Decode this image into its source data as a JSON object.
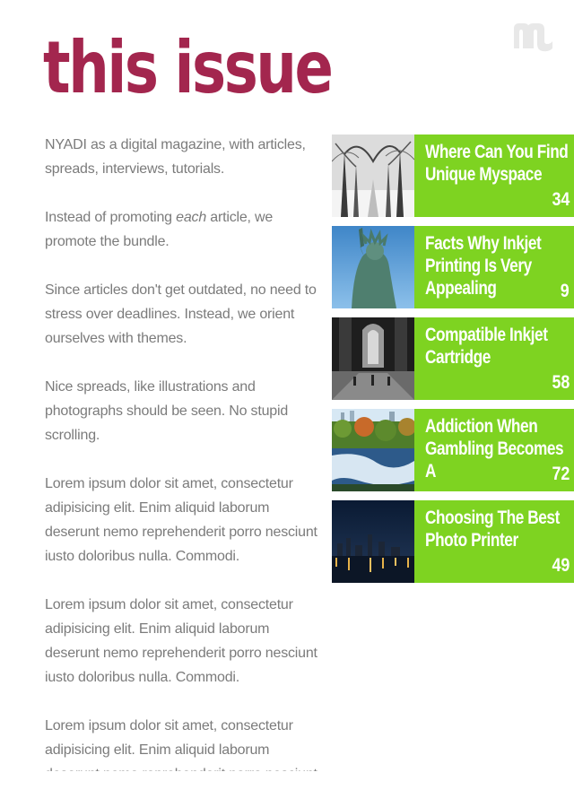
{
  "app": {
    "logo_icon": "magazine-logo-icon"
  },
  "header": {
    "title": "this issue",
    "title_color": "#a3264e"
  },
  "intro": {
    "paragraphs": [
      "NYADI as a digital magazine, with articles, spreads, interviews, tutorials.",
      "Instead of promoting each article, we promote the bundle.",
      "Since articles don't get outdated, no need to stress over deadlines. Instead, we orient ourselves with themes.",
      "Nice spreads, like illustrations and photographs should be seen. No stupid scrolling.",
      "Lorem ipsum dolor sit amet, consectetur adipisicing elit. Enim aliquid laborum deserunt nemo reprehenderit porro nesciunt iusto doloribus nulla. Commodi.",
      "Lorem ipsum dolor sit amet, consectetur adipisicing elit. Enim aliquid laborum deserunt nemo reprehenderit porro nesciunt iusto doloribus nulla. Commodi.",
      "Lorem ipsum dolor sit amet, consectetur adipisicing elit. Enim aliquid laborum deserunt nemo reprehenderit porro nesciunt iusto doloribus nulla. Commodi."
    ],
    "emphasis_word": "each",
    "text_color": "#7b7b7b"
  },
  "articles": [
    {
      "title": "Where Can You Find Unique Myspace",
      "page": "34",
      "thumbnail": "snowy-park-photo"
    },
    {
      "title": "Facts Why Inkjet Printing Is Very Appealing",
      "page": "9",
      "thumbnail": "statue-of-liberty-photo"
    },
    {
      "title": "Compatible Inkjet Cartridge",
      "page": "58",
      "thumbnail": "grand-central-station-photo"
    },
    {
      "title": "Addiction When Gambling Becomes A",
      "page": "72",
      "thumbnail": "park-pond-photo"
    },
    {
      "title": "Choosing The Best Photo Printer",
      "page": "49",
      "thumbnail": "city-skyline-night-photo"
    }
  ],
  "colors": {
    "card_background": "#7ed321",
    "card_text": "#ffffff"
  }
}
